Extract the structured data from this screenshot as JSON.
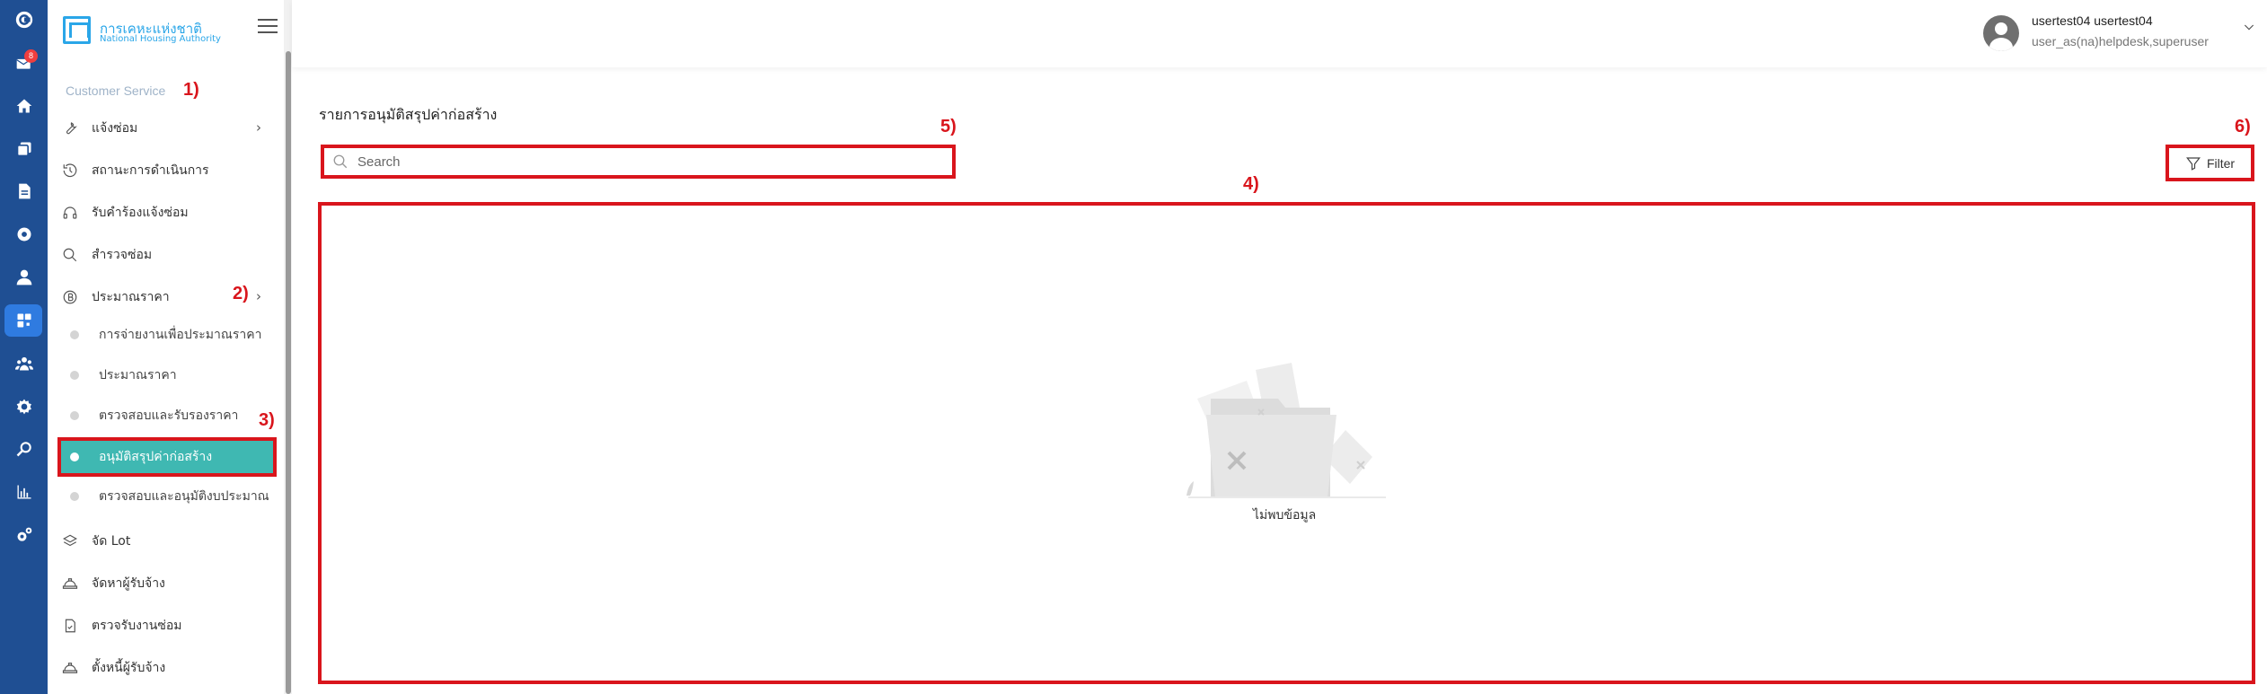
{
  "rail": {
    "mail_badge": "8"
  },
  "brand": {
    "name_th": "การเคหะแห่งชาติ",
    "name_en": "National Housing Authority"
  },
  "sidebar": {
    "section_label": "Customer Service",
    "items": [
      {
        "label": "แจ้งซ่อม",
        "icon": "wrench-icon"
      },
      {
        "label": "สถานะการดำเนินการ",
        "icon": "history-icon"
      },
      {
        "label": "รับคำร้องแจ้งซ่อม",
        "icon": "headset-icon"
      },
      {
        "label": "สำรวจซ่อม",
        "icon": "search-icon"
      },
      {
        "label": "ประมาณราคา",
        "icon": "baht-coin-icon"
      }
    ],
    "sub_items": [
      {
        "label": "การจ่ายงานเพื่อประมาณราคา"
      },
      {
        "label": "ประมาณราคา"
      },
      {
        "label": "ตรวจสอบและรับรองราคา"
      },
      {
        "label": "อนุมัติสรุปค่าก่อสร้าง"
      },
      {
        "label": "ตรวจสอบและอนุมัติงบประมาณ"
      }
    ],
    "items_after": [
      {
        "label": "จัด Lot",
        "icon": "layers-icon"
      },
      {
        "label": "จัดหาผู้รับจ้าง",
        "icon": "hard-hat-icon"
      },
      {
        "label": "ตรวจรับงานซ่อม",
        "icon": "document-check-icon"
      },
      {
        "label": "ตั้งหนี้ผู้รับจ้าง",
        "icon": "hard-hat-icon"
      }
    ]
  },
  "annotations": [
    "1)",
    "2)",
    "3)",
    "4)",
    "5)",
    "6)"
  ],
  "user": {
    "name": "usertest04 usertest04",
    "role": "user_as(na)helpdesk,superuser"
  },
  "main": {
    "title": "รายการอนุมัติสรุปค่าก่อสร้าง",
    "search_placeholder": "Search",
    "filter_label": "Filter",
    "empty_text": "ไม่พบข้อมูล"
  },
  "colors": {
    "rail_bg": "#1f4f93",
    "rail_active": "#2f7be0",
    "active_submenu": "#3fb8b2",
    "annotation_red": "#d9151c",
    "brand_blue": "#2aa6e8"
  }
}
